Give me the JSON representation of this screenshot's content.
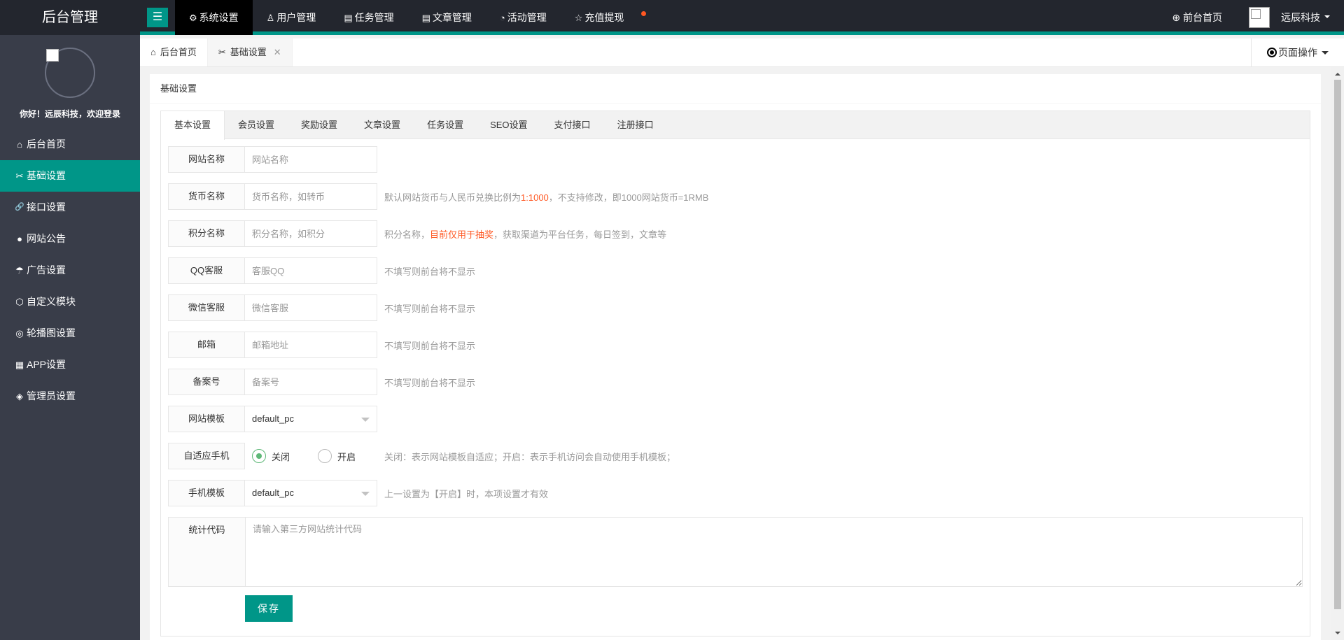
{
  "sidebar": {
    "logo": "后台管理",
    "welcome": "你好！远辰科技，欢迎登录",
    "items": [
      {
        "label": "后台首页",
        "icon": "⌂"
      },
      {
        "label": "基础设置",
        "icon": "✂"
      },
      {
        "label": "接口设置",
        "icon": "🔗"
      },
      {
        "label": "网站公告",
        "icon": "●"
      },
      {
        "label": "广告设置",
        "icon": "☂"
      },
      {
        "label": "自定义模块",
        "icon": "⬡"
      },
      {
        "label": "轮播图设置",
        "icon": "◎"
      },
      {
        "label": "APP设置",
        "icon": "▦"
      },
      {
        "label": "管理员设置",
        "icon": "◈"
      }
    ]
  },
  "header": {
    "toggle_icon": "☰",
    "nav": [
      {
        "label": "系统设置",
        "icon": "⚙"
      },
      {
        "label": "用户管理",
        "icon": "♙"
      },
      {
        "label": "任务管理",
        "icon": "▤"
      },
      {
        "label": "文章管理",
        "icon": "▤"
      },
      {
        "label": "活动管理",
        "icon": "◔"
      },
      {
        "label": "充值提现",
        "icon": "☆"
      }
    ],
    "front_link": "前台首页",
    "front_icon": "⊕",
    "user": "远辰科技"
  },
  "tabbar": {
    "home": "后台首页",
    "home_icon": "⌂",
    "current": "基础设置",
    "current_icon": "✂",
    "close": "✕",
    "page_ops": "页面操作"
  },
  "card": {
    "title": "基础设置",
    "tabs": [
      "基本设置",
      "会员设置",
      "奖励设置",
      "文章设置",
      "任务设置",
      "SEO设置",
      "支付接口",
      "注册接口"
    ]
  },
  "form": {
    "site_name": {
      "label": "网站名称",
      "placeholder": "网站名称"
    },
    "currency": {
      "label": "货币名称",
      "placeholder": "货币名称，如转币",
      "aux_pre": "默认网站货币与人民币兑换比例为",
      "aux_hl": "1:1000",
      "aux_post": "，不支持修改，即1000网站货币=1RMB"
    },
    "points": {
      "label": "积分名称",
      "placeholder": "积分名称，如积分",
      "aux_pre": "积分名称，",
      "aux_hl": "目前仅用于抽奖",
      "aux_post": "，获取渠道为平台任务，每日签到，文章等"
    },
    "qq": {
      "label": "QQ客服",
      "placeholder": "客服QQ",
      "aux": "不填写则前台将不显示"
    },
    "wechat": {
      "label": "微信客服",
      "placeholder": "微信客服",
      "aux": "不填写则前台将不显示"
    },
    "email": {
      "label": "邮箱",
      "placeholder": "邮箱地址",
      "aux": "不填写则前台将不显示"
    },
    "icp": {
      "label": "备案号",
      "placeholder": "备案号",
      "aux": "不填写则前台将不显示"
    },
    "template": {
      "label": "网站模板",
      "value": "default_pc"
    },
    "adaptive": {
      "label": "自适应手机",
      "option_off": "关闭",
      "option_on": "开启",
      "selected": "关闭",
      "aux": "关闭：表示网站模板自适应；开启：表示手机访问会自动使用手机模板；"
    },
    "mobile_template": {
      "label": "手机模板",
      "value": "default_pc",
      "aux": "上一设置为【开启】时，本项设置才有效"
    },
    "stats": {
      "label": "统计代码",
      "placeholder": "请输入第三方网站统计代码"
    },
    "save_label": "保存"
  },
  "colors": {
    "accent": "#009688",
    "highlight": "#ff5722",
    "sidebar_bg": "#393d49",
    "header_bg": "#23262e"
  }
}
